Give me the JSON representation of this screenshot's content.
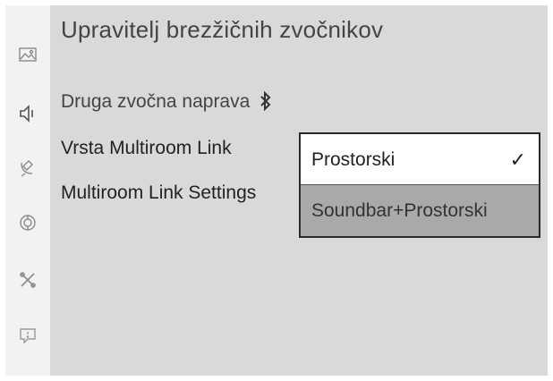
{
  "sidebar": {
    "icons": [
      "picture-icon",
      "sound-icon",
      "broadcast-icon",
      "general-icon",
      "support-tools-icon",
      "help-icon"
    ]
  },
  "panel": {
    "title": "Upravitelj brezžičnih zvočnikov",
    "items": [
      {
        "label": "Druga zvočna naprava",
        "icon": "bluetooth-icon"
      },
      {
        "label": "Vrsta Multiroom Link"
      },
      {
        "label": "Multiroom Link Settings"
      }
    ]
  },
  "dropdown": {
    "options": [
      {
        "label": "Prostorski",
        "selected": true,
        "mark": "✓"
      },
      {
        "label": "Soundbar+Prostorski",
        "selected": false
      }
    ]
  }
}
